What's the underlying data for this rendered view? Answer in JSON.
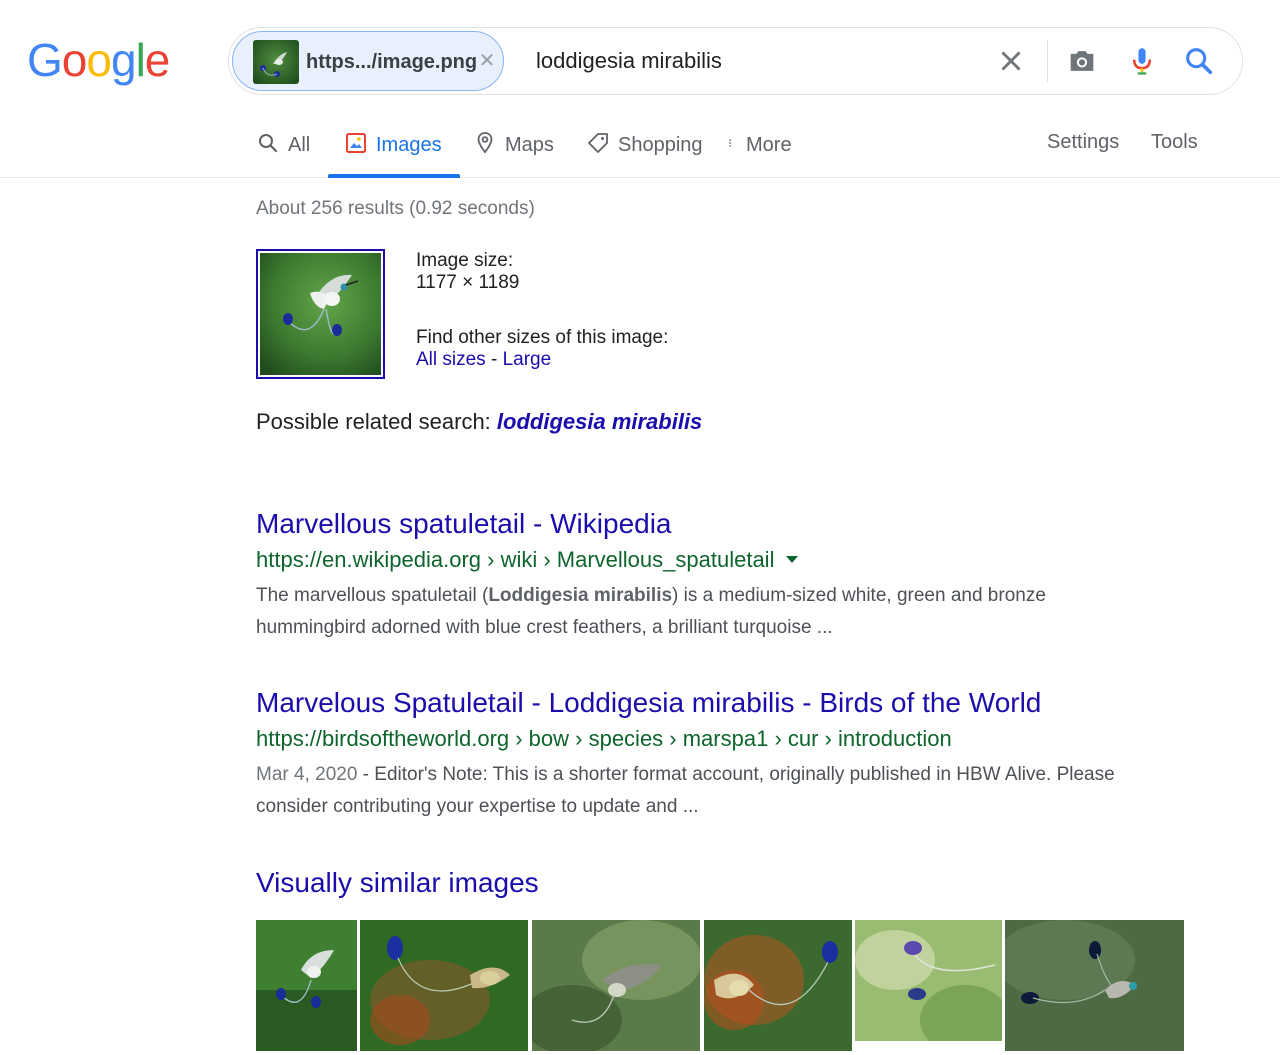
{
  "logo": {
    "text": "Google"
  },
  "search": {
    "chip_label": "https.../image.png",
    "query": "loddigesia mirabilis"
  },
  "tabs": [
    {
      "label": "All",
      "icon": "search-icon"
    },
    {
      "label": "Images",
      "icon": "image-icon",
      "active": true
    },
    {
      "label": "Maps",
      "icon": "map-pin-icon"
    },
    {
      "label": "Shopping",
      "icon": "tag-icon"
    },
    {
      "label": "More",
      "icon": "more-vert-icon"
    }
  ],
  "tools": {
    "settings": "Settings",
    "tools": "Tools"
  },
  "stats": "About 256 results (0.92 seconds)",
  "image_info": {
    "size_label": "Image size:",
    "size_value": "1177 × 1189",
    "find_other": "Find other sizes of this image:",
    "all_sizes": "All sizes",
    "separator": " - ",
    "large": "Large"
  },
  "related": {
    "label": "Possible related search: ",
    "query": "loddigesia mirabilis"
  },
  "results": [
    {
      "title": "Marvellous spatuletail - Wikipedia",
      "url": "https://en.wikipedia.org › wiki › Marvellous_spatuletail",
      "snippet_pre": "The marvellous spatuletail (",
      "snippet_bold": "Loddigesia mirabilis",
      "snippet_post": ") is a medium-sized white, green and bronze hummingbird adorned with blue crest feathers, a brilliant turquoise ..."
    },
    {
      "title": "Marvelous Spatuletail - Loddigesia mirabilis - Birds of the World",
      "url": "https://birdsoftheworld.org › bow › species › marspa1 › cur › introduction",
      "date": "Mar 4, 2020",
      "snippet_post": " - Editor's Note: This is a shorter format account, originally published in HBW Alive. Please consider contributing your expertise to update and ..."
    }
  ],
  "similar": {
    "title": "Visually similar images"
  },
  "colors": {
    "link": "#1a0dab",
    "url_green": "#0d652d",
    "accent_blue": "#1a73e8",
    "google_blue": "#4285f4",
    "google_red": "#ea4335",
    "google_yellow": "#fbbc05",
    "google_green": "#34a853"
  }
}
